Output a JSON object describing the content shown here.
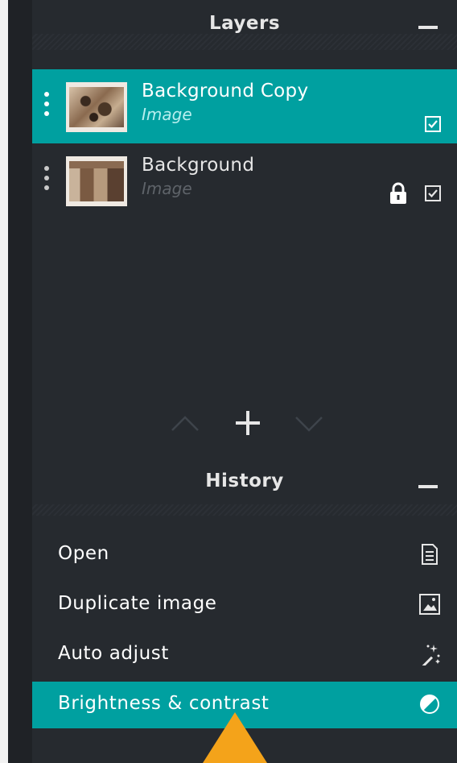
{
  "layers_panel": {
    "title": "Layers",
    "layers": [
      {
        "name": "Background Copy",
        "type": "Image",
        "selected": true,
        "locked": false,
        "visible": true,
        "thumbnail": "photo-thumbnail"
      },
      {
        "name": "Background",
        "type": "Image",
        "selected": false,
        "locked": true,
        "visible": true,
        "thumbnail": "photo-thumbnail"
      }
    ],
    "actions": [
      "move-up-icon",
      "add-layer-icon",
      "move-down-icon"
    ]
  },
  "history_panel": {
    "title": "History",
    "items": [
      {
        "label": "Open",
        "icon": "document-icon",
        "selected": false
      },
      {
        "label": "Duplicate image",
        "icon": "image-icon",
        "selected": false
      },
      {
        "label": "Auto adjust",
        "icon": "magic-wand-icon",
        "selected": false
      },
      {
        "label": "Brightness & contrast",
        "icon": "contrast-icon",
        "selected": true
      }
    ]
  },
  "colors": {
    "accent": "#00a0a0",
    "panel_bg": "#262a2f",
    "pointer": "#f4a31a"
  }
}
